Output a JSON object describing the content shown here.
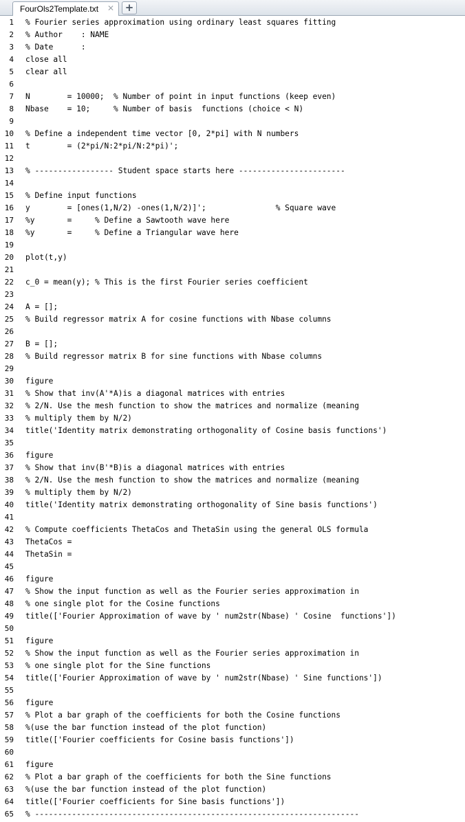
{
  "tab": {
    "title": "FourOls2Template.txt",
    "close_glyph": "✕",
    "add_glyph": "+"
  },
  "lines": [
    {
      "n": "1",
      "text": "% Fourier series approximation using ordinary least squares fitting"
    },
    {
      "n": "2",
      "text": "% Author    : NAME"
    },
    {
      "n": "3",
      "text": "% Date      :"
    },
    {
      "n": "4",
      "text": "close all"
    },
    {
      "n": "5",
      "text": "clear all"
    },
    {
      "n": "6",
      "text": ""
    },
    {
      "n": "7",
      "text": "N        = 10000;  % Number of point in input functions (keep even)"
    },
    {
      "n": "8",
      "text": "Nbase    = 10;     % Number of basis  functions (choice < N)"
    },
    {
      "n": "9",
      "text": ""
    },
    {
      "n": "10",
      "text": "% Define a independent time vector [0, 2*pi] with N numbers"
    },
    {
      "n": "11",
      "text": "t        = (2*pi/N:2*pi/N:2*pi)';"
    },
    {
      "n": "12",
      "text": ""
    },
    {
      "n": "13",
      "text": "% ----------------- Student space starts here -----------------------"
    },
    {
      "n": "14",
      "text": ""
    },
    {
      "n": "15",
      "text": "% Define input functions"
    },
    {
      "n": "16",
      "text": "y        = [ones(1,N/2) -ones(1,N/2)]';               % Square wave"
    },
    {
      "n": "17",
      "text": "%y       =     % Define a Sawtooth wave here"
    },
    {
      "n": "18",
      "text": "%y       =     % Define a Triangular wave here"
    },
    {
      "n": "19",
      "text": ""
    },
    {
      "n": "20",
      "text": "plot(t,y)"
    },
    {
      "n": "21",
      "text": ""
    },
    {
      "n": "22",
      "text": "c_0 = mean(y); % This is the first Fourier series coefficient"
    },
    {
      "n": "23",
      "text": ""
    },
    {
      "n": "24",
      "text": "A = [];"
    },
    {
      "n": "25",
      "text": "% Build regressor matrix A for cosine functions with Nbase columns"
    },
    {
      "n": "26",
      "text": ""
    },
    {
      "n": "27",
      "text": "B = [];"
    },
    {
      "n": "28",
      "text": "% Build regressor matrix B for sine functions with Nbase columns"
    },
    {
      "n": "29",
      "text": ""
    },
    {
      "n": "30",
      "text": "figure"
    },
    {
      "n": "31",
      "text": "% Show that inv(A'*A)is a diagonal matrices with entries"
    },
    {
      "n": "32",
      "text": "% 2/N. Use the mesh function to show the matrices and normalize (meaning"
    },
    {
      "n": "33",
      "text": "% multiply them by N/2)"
    },
    {
      "n": "34",
      "text": "title('Identity matrix demonstrating orthogonality of Cosine basis functions')"
    },
    {
      "n": "35",
      "text": ""
    },
    {
      "n": "36",
      "text": "figure"
    },
    {
      "n": "37",
      "text": "% Show that inv(B'*B)is a diagonal matrices with entries"
    },
    {
      "n": "38",
      "text": "% 2/N. Use the mesh function to show the matrices and normalize (meaning"
    },
    {
      "n": "39",
      "text": "% multiply them by N/2)"
    },
    {
      "n": "40",
      "text": "title('Identity matrix demonstrating orthogonality of Sine basis functions')"
    },
    {
      "n": "41",
      "text": ""
    },
    {
      "n": "42",
      "text": "% Compute coefficients ThetaCos and ThetaSin using the general OLS formula"
    },
    {
      "n": "43",
      "text": "ThetaCos ="
    },
    {
      "n": "44",
      "text": "ThetaSin ="
    },
    {
      "n": "45",
      "text": ""
    },
    {
      "n": "46",
      "text": "figure"
    },
    {
      "n": "47",
      "text": "% Show the input function as well as the Fourier series approximation in"
    },
    {
      "n": "48",
      "text": "% one single plot for the Cosine functions"
    },
    {
      "n": "49",
      "text": "title(['Fourier Approximation of wave by ' num2str(Nbase) ' Cosine  functions'])"
    },
    {
      "n": "50",
      "text": ""
    },
    {
      "n": "51",
      "text": "figure"
    },
    {
      "n": "52",
      "text": "% Show the input function as well as the Fourier series approximation in"
    },
    {
      "n": "53",
      "text": "% one single plot for the Sine functions"
    },
    {
      "n": "54",
      "text": "title(['Fourier Approximation of wave by ' num2str(Nbase) ' Sine functions'])"
    },
    {
      "n": "55",
      "text": ""
    },
    {
      "n": "56",
      "text": "figure"
    },
    {
      "n": "57",
      "text": "% Plot a bar graph of the coefficients for both the Cosine functions"
    },
    {
      "n": "58",
      "text": "%(use the bar function instead of the plot function)"
    },
    {
      "n": "59",
      "text": "title(['Fourier coefficients for Cosine basis functions'])"
    },
    {
      "n": "60",
      "text": ""
    },
    {
      "n": "61",
      "text": "figure"
    },
    {
      "n": "62",
      "text": "% Plot a bar graph of the coefficients for both the Sine functions"
    },
    {
      "n": "63",
      "text": "%(use the bar function instead of the plot function)"
    },
    {
      "n": "64",
      "text": "title(['Fourier coefficients for Sine basis functions'])"
    },
    {
      "n": "65",
      "text": "% ----------------------------------------------------------------------"
    }
  ]
}
